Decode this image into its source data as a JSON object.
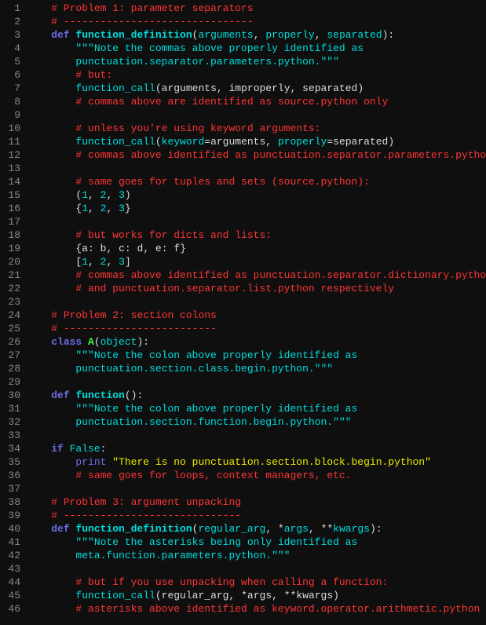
{
  "gutter": {
    "start": 1,
    "end": 46
  },
  "lines": [
    [
      [
        "    ",
        ""
      ],
      [
        "# Problem 1: parameter separators",
        "comment"
      ]
    ],
    [
      [
        "    ",
        ""
      ],
      [
        "# -------------------------------",
        "comment"
      ]
    ],
    [
      [
        "    ",
        ""
      ],
      [
        "def ",
        "keyword"
      ],
      [
        "function_definition",
        "funcname"
      ],
      [
        "(",
        "paren"
      ],
      [
        "arguments",
        "param"
      ],
      [
        ", ",
        "punct"
      ],
      [
        "properly",
        "param"
      ],
      [
        ", ",
        "punct"
      ],
      [
        "separated",
        "param"
      ],
      [
        "):",
        "paren"
      ]
    ],
    [
      [
        "        ",
        ""
      ],
      [
        "\"\"\"Note the commas above properly identified as",
        "string"
      ]
    ],
    [
      [
        "        ",
        ""
      ],
      [
        "punctuation.separator.parameters.python.\"\"\"",
        "string"
      ]
    ],
    [
      [
        "        ",
        ""
      ],
      [
        "# but:",
        "comment"
      ]
    ],
    [
      [
        "        ",
        ""
      ],
      [
        "function_call",
        "call"
      ],
      [
        "(",
        "paren"
      ],
      [
        "arguments",
        "ident"
      ],
      [
        ", ",
        "punct"
      ],
      [
        "improperly",
        "ident"
      ],
      [
        ", ",
        "punct"
      ],
      [
        "separated",
        "ident"
      ],
      [
        ")",
        "paren"
      ]
    ],
    [
      [
        "        ",
        ""
      ],
      [
        "# commas above are identified as source.python only",
        "comment"
      ]
    ],
    [
      [
        "",
        ""
      ]
    ],
    [
      [
        "        ",
        ""
      ],
      [
        "# unless you're using keyword arguments:",
        "comment"
      ]
    ],
    [
      [
        "        ",
        ""
      ],
      [
        "function_call",
        "call"
      ],
      [
        "(",
        "paren"
      ],
      [
        "keyword",
        "param"
      ],
      [
        "=",
        "punct"
      ],
      [
        "arguments",
        "ident"
      ],
      [
        ", ",
        "punct"
      ],
      [
        "properly",
        "param"
      ],
      [
        "=",
        "punct"
      ],
      [
        "separated",
        "ident"
      ],
      [
        ")",
        "paren"
      ]
    ],
    [
      [
        "        ",
        ""
      ],
      [
        "# commas above identified as punctuation.separator.parameters.pytho",
        "comment"
      ]
    ],
    [
      [
        "",
        ""
      ]
    ],
    [
      [
        "        ",
        ""
      ],
      [
        "# same goes for tuples and sets (source.python):",
        "comment"
      ]
    ],
    [
      [
        "        ",
        ""
      ],
      [
        "(",
        "paren"
      ],
      [
        "1",
        "num"
      ],
      [
        ", ",
        "punct"
      ],
      [
        "2",
        "num"
      ],
      [
        ", ",
        "punct"
      ],
      [
        "3",
        "num"
      ],
      [
        ")",
        "paren"
      ]
    ],
    [
      [
        "        ",
        ""
      ],
      [
        "{",
        "paren"
      ],
      [
        "1",
        "num"
      ],
      [
        ", ",
        "punct"
      ],
      [
        "2",
        "num"
      ],
      [
        ", ",
        "punct"
      ],
      [
        "3",
        "num"
      ],
      [
        "}",
        "paren"
      ]
    ],
    [
      [
        "",
        ""
      ]
    ],
    [
      [
        "        ",
        ""
      ],
      [
        "# but works for dicts and lists:",
        "comment"
      ]
    ],
    [
      [
        "        ",
        ""
      ],
      [
        "{",
        "paren"
      ],
      [
        "a",
        "ident"
      ],
      [
        ": ",
        "punct"
      ],
      [
        "b",
        "ident"
      ],
      [
        ", ",
        "punct"
      ],
      [
        "c",
        "ident"
      ],
      [
        ": ",
        "punct"
      ],
      [
        "d",
        "ident"
      ],
      [
        ", ",
        "punct"
      ],
      [
        "e",
        "ident"
      ],
      [
        ": ",
        "punct"
      ],
      [
        "f",
        "ident"
      ],
      [
        "}",
        "paren"
      ]
    ],
    [
      [
        "        ",
        ""
      ],
      [
        "[",
        "paren"
      ],
      [
        "1",
        "num"
      ],
      [
        ", ",
        "punct"
      ],
      [
        "2",
        "num"
      ],
      [
        ", ",
        "punct"
      ],
      [
        "3",
        "num"
      ],
      [
        "]",
        "paren"
      ]
    ],
    [
      [
        "        ",
        ""
      ],
      [
        "# commas above identified as punctuation.separator.dictionary.pytho",
        "comment"
      ]
    ],
    [
      [
        "        ",
        ""
      ],
      [
        "# and punctuation.separator.list.python respectively",
        "comment"
      ]
    ],
    [
      [
        "",
        ""
      ]
    ],
    [
      [
        "    ",
        ""
      ],
      [
        "# Problem 2: section colons",
        "comment"
      ]
    ],
    [
      [
        "    ",
        ""
      ],
      [
        "# -------------------------",
        "comment"
      ]
    ],
    [
      [
        "    ",
        ""
      ],
      [
        "class ",
        "keyword"
      ],
      [
        "A",
        "classname"
      ],
      [
        "(",
        "paren"
      ],
      [
        "object",
        "builtin"
      ],
      [
        "):",
        "paren"
      ]
    ],
    [
      [
        "        ",
        ""
      ],
      [
        "\"\"\"Note the colon above properly identified as",
        "string"
      ]
    ],
    [
      [
        "        ",
        ""
      ],
      [
        "punctuation.section.class.begin.python.\"\"\"",
        "string"
      ]
    ],
    [
      [
        "",
        ""
      ]
    ],
    [
      [
        "    ",
        ""
      ],
      [
        "def ",
        "keyword"
      ],
      [
        "function",
        "funcname"
      ],
      [
        "():",
        "paren"
      ]
    ],
    [
      [
        "        ",
        ""
      ],
      [
        "\"\"\"Note the colon above properly identified as",
        "string"
      ]
    ],
    [
      [
        "        ",
        ""
      ],
      [
        "punctuation.section.function.begin.python.\"\"\"",
        "string"
      ]
    ],
    [
      [
        "",
        ""
      ]
    ],
    [
      [
        "    ",
        ""
      ],
      [
        "if ",
        "keyword"
      ],
      [
        "False",
        "builtin"
      ],
      [
        ":",
        "punct"
      ]
    ],
    [
      [
        "        ",
        ""
      ],
      [
        "print ",
        "keyword2"
      ],
      [
        "\"There is no punctuation.section.block.begin.python\"",
        "stringy"
      ]
    ],
    [
      [
        "        ",
        ""
      ],
      [
        "# same goes for loops, context managers, etc.",
        "comment"
      ]
    ],
    [
      [
        "",
        ""
      ]
    ],
    [
      [
        "    ",
        ""
      ],
      [
        "# Problem 3: argument unpacking",
        "comment"
      ]
    ],
    [
      [
        "    ",
        ""
      ],
      [
        "# -----------------------------",
        "comment"
      ]
    ],
    [
      [
        "    ",
        ""
      ],
      [
        "def ",
        "keyword"
      ],
      [
        "function_definition",
        "funcname"
      ],
      [
        "(",
        "paren"
      ],
      [
        "regular_arg",
        "param"
      ],
      [
        ", ",
        "punct"
      ],
      [
        "*",
        "punct"
      ],
      [
        "args",
        "param"
      ],
      [
        ", ",
        "punct"
      ],
      [
        "**",
        "punct"
      ],
      [
        "kwargs",
        "param"
      ],
      [
        "):",
        "paren"
      ]
    ],
    [
      [
        "        ",
        ""
      ],
      [
        "\"\"\"Note the asterisks being only identified as",
        "string"
      ]
    ],
    [
      [
        "        ",
        ""
      ],
      [
        "meta.function.parameters.python.\"\"\"",
        "string"
      ]
    ],
    [
      [
        "",
        ""
      ]
    ],
    [
      [
        "        ",
        ""
      ],
      [
        "# but if you use unpacking when calling a function:",
        "comment"
      ]
    ],
    [
      [
        "        ",
        ""
      ],
      [
        "function_call",
        "call"
      ],
      [
        "(",
        "paren"
      ],
      [
        "regular_arg",
        "ident"
      ],
      [
        ", ",
        "punct"
      ],
      [
        "*",
        "punct"
      ],
      [
        "args",
        "ident"
      ],
      [
        ", ",
        "punct"
      ],
      [
        "**",
        "punct"
      ],
      [
        "kwargs",
        "ident"
      ],
      [
        ")",
        "paren"
      ]
    ],
    [
      [
        "        ",
        ""
      ],
      [
        "# asterisks above identified as keyword.operator.arithmetic.python",
        "comment"
      ]
    ]
  ]
}
